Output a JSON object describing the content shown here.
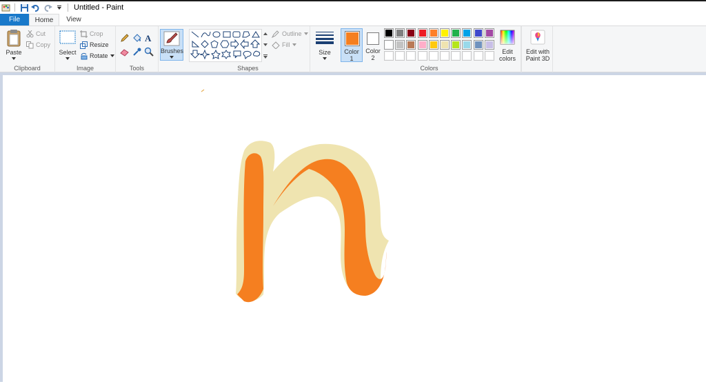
{
  "window": {
    "title": "Untitled - Paint"
  },
  "tabs": {
    "file": "File",
    "home": "Home",
    "view": "View"
  },
  "clipboard": {
    "paste": "Paste",
    "cut": "Cut",
    "copy": "Copy",
    "label": "Clipboard"
  },
  "image": {
    "select": "Select",
    "crop": "Crop",
    "resize": "Resize",
    "rotate": "Rotate",
    "label": "Image"
  },
  "tools": {
    "label": "Tools"
  },
  "brushes": {
    "label": "Brushes"
  },
  "shapes": {
    "outline": "Outline",
    "fill": "Fill",
    "label": "Shapes"
  },
  "size": {
    "label": "Size"
  },
  "color1": {
    "line1": "Color",
    "line2": "1",
    "value": "#f57f20"
  },
  "color2": {
    "line1": "Color",
    "line2": "2",
    "value": "#ffffff"
  },
  "colors": {
    "label": "Colors",
    "row1": [
      "#000000",
      "#7f7f7f",
      "#880015",
      "#ed1c24",
      "#ff7f27",
      "#fff200",
      "#22b14c",
      "#00a2e8",
      "#3f48cc",
      "#a349a4"
    ],
    "row2": [
      "#ffffff",
      "#c3c3c3",
      "#b97a57",
      "#ffaec9",
      "#ffc90e",
      "#efe4b0",
      "#b5e61d",
      "#99d9ea",
      "#7092be",
      "#c8bfe7"
    ],
    "row3": [
      "#ffffff",
      "#ffffff",
      "#ffffff",
      "#ffffff",
      "#ffffff",
      "#ffffff",
      "#ffffff",
      "#ffffff",
      "#ffffff",
      "#ffffff"
    ]
  },
  "edit_colors": {
    "line1": "Edit",
    "line2": "colors"
  },
  "paint3d": {
    "line1": "Edit with",
    "line2": "Paint 3D"
  },
  "drawing": {
    "fill_color": "#f57f20",
    "outline_color": "#efe4b0"
  }
}
